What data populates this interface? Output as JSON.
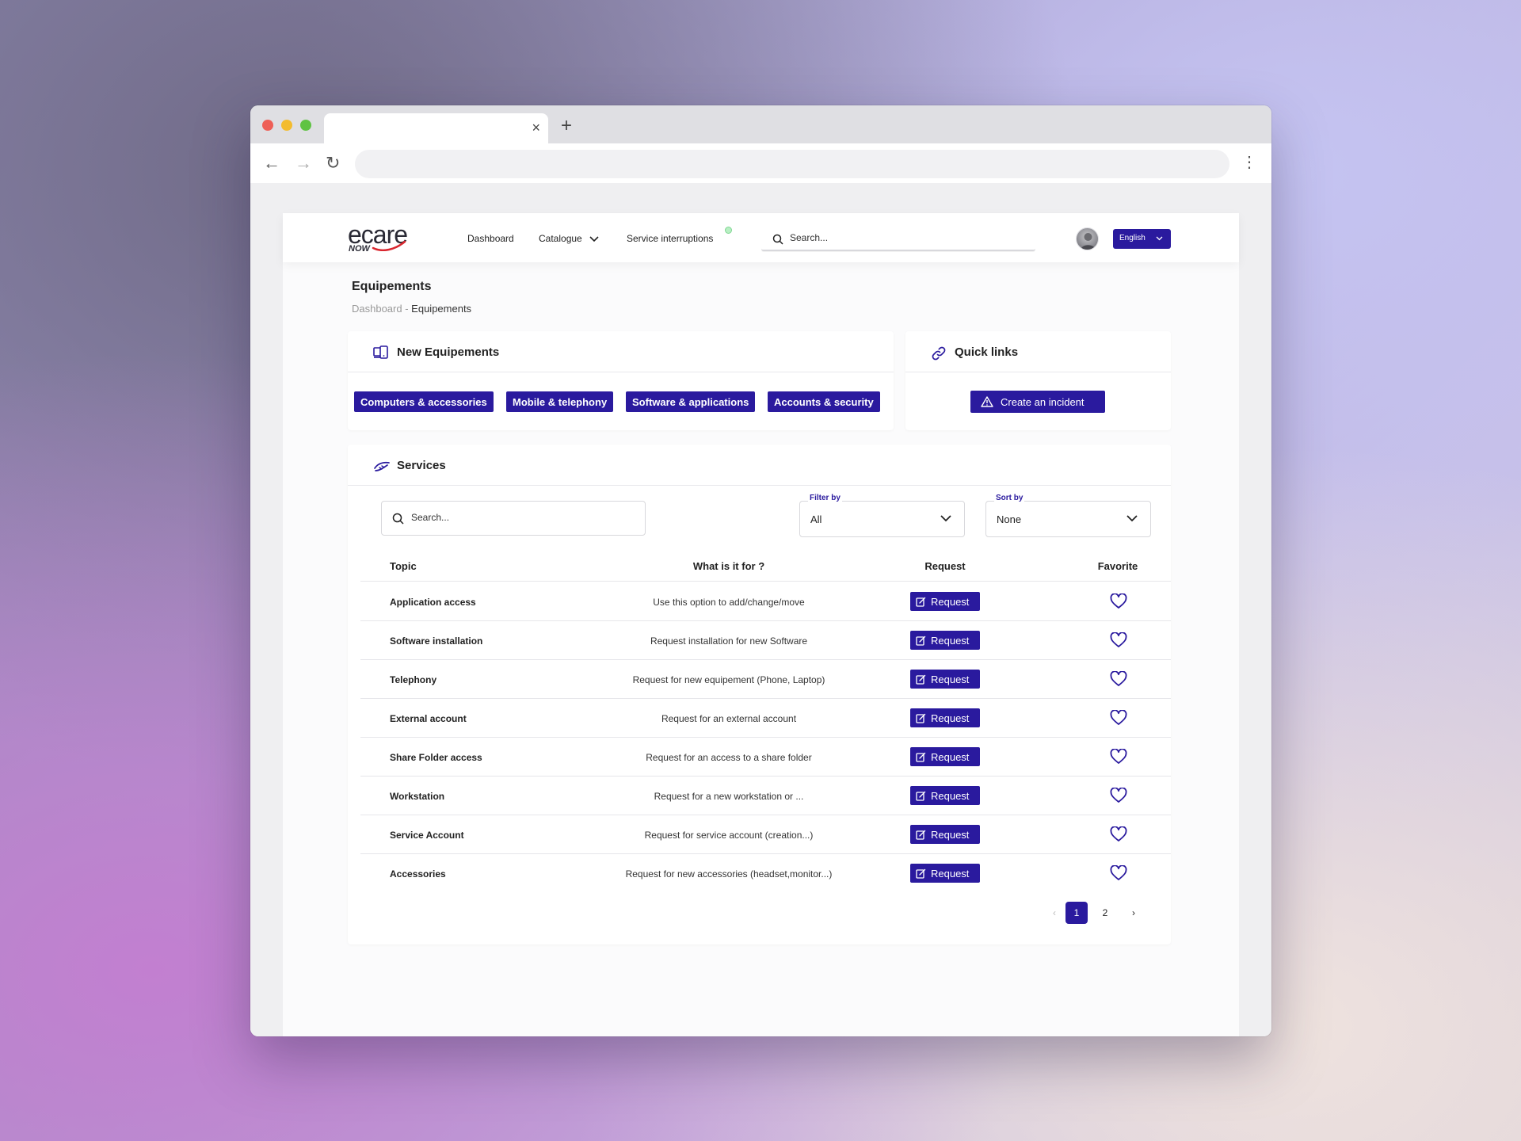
{
  "browser": {
    "tab_close": "×",
    "new_tab": "+",
    "back": "←",
    "forward": "→",
    "reload": "↻",
    "menu": "⋮"
  },
  "header": {
    "logo_text": "ecare",
    "logo_sub": "NOW",
    "nav": {
      "dashboard": "Dashboard",
      "catalogue": "Catalogue",
      "service_interruptions": "Service interruptions"
    },
    "search_placeholder": "Search...",
    "language": "English"
  },
  "page": {
    "title": "Equipements",
    "breadcrumb": {
      "root": "Dashboard",
      "separator": " - ",
      "current": "Equipements"
    }
  },
  "new_equipements": {
    "title": "New Equipements",
    "chips": [
      "Computers & accessories",
      "Mobile & telephony",
      "Software & applications",
      "Accounts & security"
    ]
  },
  "quick_links": {
    "title": "Quick links",
    "incident_button": "Create an incident"
  },
  "services": {
    "title": "Services",
    "search_placeholder": "Search...",
    "filter": {
      "label": "Filter by",
      "value": "All"
    },
    "sort": {
      "label": "Sort by",
      "value": "None"
    },
    "columns": {
      "topic": "Topic",
      "purpose": "What is it for ?",
      "request": "Request",
      "favorite": "Favorite"
    },
    "request_label": "Request",
    "rows": [
      {
        "topic": "Application access",
        "purpose": "Use this option to add/change/move"
      },
      {
        "topic": "Software installation",
        "purpose": "Request installation for new Software"
      },
      {
        "topic": "Telephony",
        "purpose": "Request for new equipement (Phone, Laptop)"
      },
      {
        "topic": "External account",
        "purpose": "Request for an external account"
      },
      {
        "topic": "Share Folder access",
        "purpose": "Request for an access to a share folder"
      },
      {
        "topic": "Workstation",
        "purpose": "Request for a new workstation or ..."
      },
      {
        "topic": "Service Account",
        "purpose": "Request for service account (creation...)"
      },
      {
        "topic": "Accessories",
        "purpose": "Request for new accessories (headset,monitor...)"
      }
    ],
    "pagination": {
      "prev": "‹",
      "pages": [
        "1",
        "2"
      ],
      "current": "1",
      "next": "›"
    }
  },
  "colors": {
    "primary": "#2a1a9e",
    "logo_accent": "#d9262e",
    "status_dot": "#b8efc3"
  }
}
